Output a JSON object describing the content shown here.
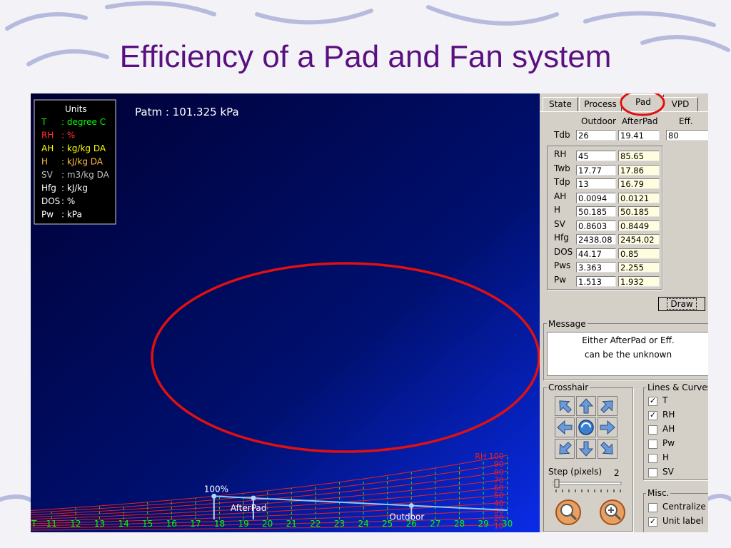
{
  "slide": {
    "title": "Efficiency of a Pad and Fan system"
  },
  "chart": {
    "patm_label": "Patm : 101.325  kPa",
    "units_title": "Units",
    "units": [
      {
        "abbr": "T",
        "desc": ": degree C",
        "color": "#00ff00"
      },
      {
        "abbr": "RH",
        "desc": ":  %",
        "color": "#ff3030"
      },
      {
        "abbr": "AH",
        "desc": ": kg/kg DA",
        "color": "#ffff00"
      },
      {
        "abbr": "H",
        "desc": ": kJ/kg DA",
        "color": "#ffc040"
      },
      {
        "abbr": "SV",
        "desc": ": m3/kg DA",
        "color": "#c0c0c0"
      },
      {
        "abbr": "Hfg",
        "desc": ": kJ/kg",
        "color": "#ffffff"
      },
      {
        "abbr": "DOS",
        "desc": ":  %",
        "color": "#ffffff"
      },
      {
        "abbr": "Pw",
        "desc": ": kPa",
        "color": "#ffffff"
      }
    ],
    "x_ticks": [
      "11",
      "12",
      "13",
      "14",
      "15",
      "16",
      "17",
      "18",
      "19",
      "20",
      "21",
      "22",
      "23",
      "24",
      "25",
      "26",
      "27",
      "28",
      "29",
      "30"
    ],
    "x_axis_label": "T",
    "rh_labels": [
      "RH  100",
      "90",
      "80",
      "70",
      "60",
      "50",
      "40",
      "30",
      "20",
      "10"
    ],
    "point_labels": {
      "saturation": "100%",
      "afterpad": "AfterPad",
      "outdoor": "Outdoor"
    }
  },
  "chart_data": {
    "type": "scatter",
    "xlim": [
      10,
      30
    ],
    "x_ticks": [
      11,
      12,
      13,
      14,
      15,
      16,
      17,
      18,
      19,
      20,
      21,
      22,
      23,
      24,
      25,
      26,
      27,
      28,
      29,
      30
    ],
    "rh_curves": [
      10,
      20,
      30,
      40,
      50,
      60,
      70,
      80,
      90,
      100
    ],
    "points": [
      {
        "name": "100%",
        "T": 17.77,
        "RH": 100
      },
      {
        "name": "AfterPad",
        "T": 19.41,
        "RH": 85.65
      },
      {
        "name": "Outdoor",
        "T": 26,
        "RH": 45
      }
    ],
    "grid": true
  },
  "panel": {
    "tabs": [
      "State",
      "Process",
      "Pad",
      "VPD"
    ],
    "active_tab": "Pad",
    "columns": {
      "outdoor": "Outdoor",
      "afterpad": "AfterPad",
      "eff": "Eff."
    },
    "tdb": {
      "label": "Tdb",
      "outdoor": "26",
      "afterpad": "19.41",
      "eff": "80"
    },
    "rows": [
      {
        "label": "RH",
        "outdoor": "45",
        "afterpad": "85.65"
      },
      {
        "label": "Twb",
        "outdoor": "17.77",
        "afterpad": "17.86"
      },
      {
        "label": "Tdp",
        "outdoor": "13",
        "afterpad": "16.79"
      },
      {
        "label": "AH",
        "outdoor": "0.0094",
        "afterpad": "0.0121"
      },
      {
        "label": "H",
        "outdoor": "50.185",
        "afterpad": "50.185"
      },
      {
        "label": "SV",
        "outdoor": "0.8603",
        "afterpad": "0.8449"
      },
      {
        "label": "Hfg",
        "outdoor": "2438.08",
        "afterpad": "2454.02"
      },
      {
        "label": "DOS",
        "outdoor": "44.17",
        "afterpad": "0.85"
      },
      {
        "label": "Pws",
        "outdoor": "3.363",
        "afterpad": "2.255"
      },
      {
        "label": "Pw",
        "outdoor": "1.513",
        "afterpad": "1.932"
      }
    ],
    "draw_label": "Draw",
    "message_title": "Message",
    "message_lines": [
      "Either AfterPad or Eff.",
      "can be the unknown"
    ],
    "crosshair_title": "Crosshair",
    "step_label": "Step (pixels)",
    "step_value": "2",
    "lines_title": "Lines & Curves",
    "lines": [
      {
        "label": "T",
        "checked": true
      },
      {
        "label": "RH",
        "checked": true
      },
      {
        "label": "AH",
        "checked": false
      },
      {
        "label": "Pw",
        "checked": false
      },
      {
        "label": "H",
        "checked": false
      },
      {
        "label": "SV",
        "checked": false
      }
    ],
    "misc_title": "Misc.",
    "misc": [
      {
        "label": "Centralize",
        "checked": false
      },
      {
        "label": "Unit label",
        "checked": true
      }
    ]
  }
}
